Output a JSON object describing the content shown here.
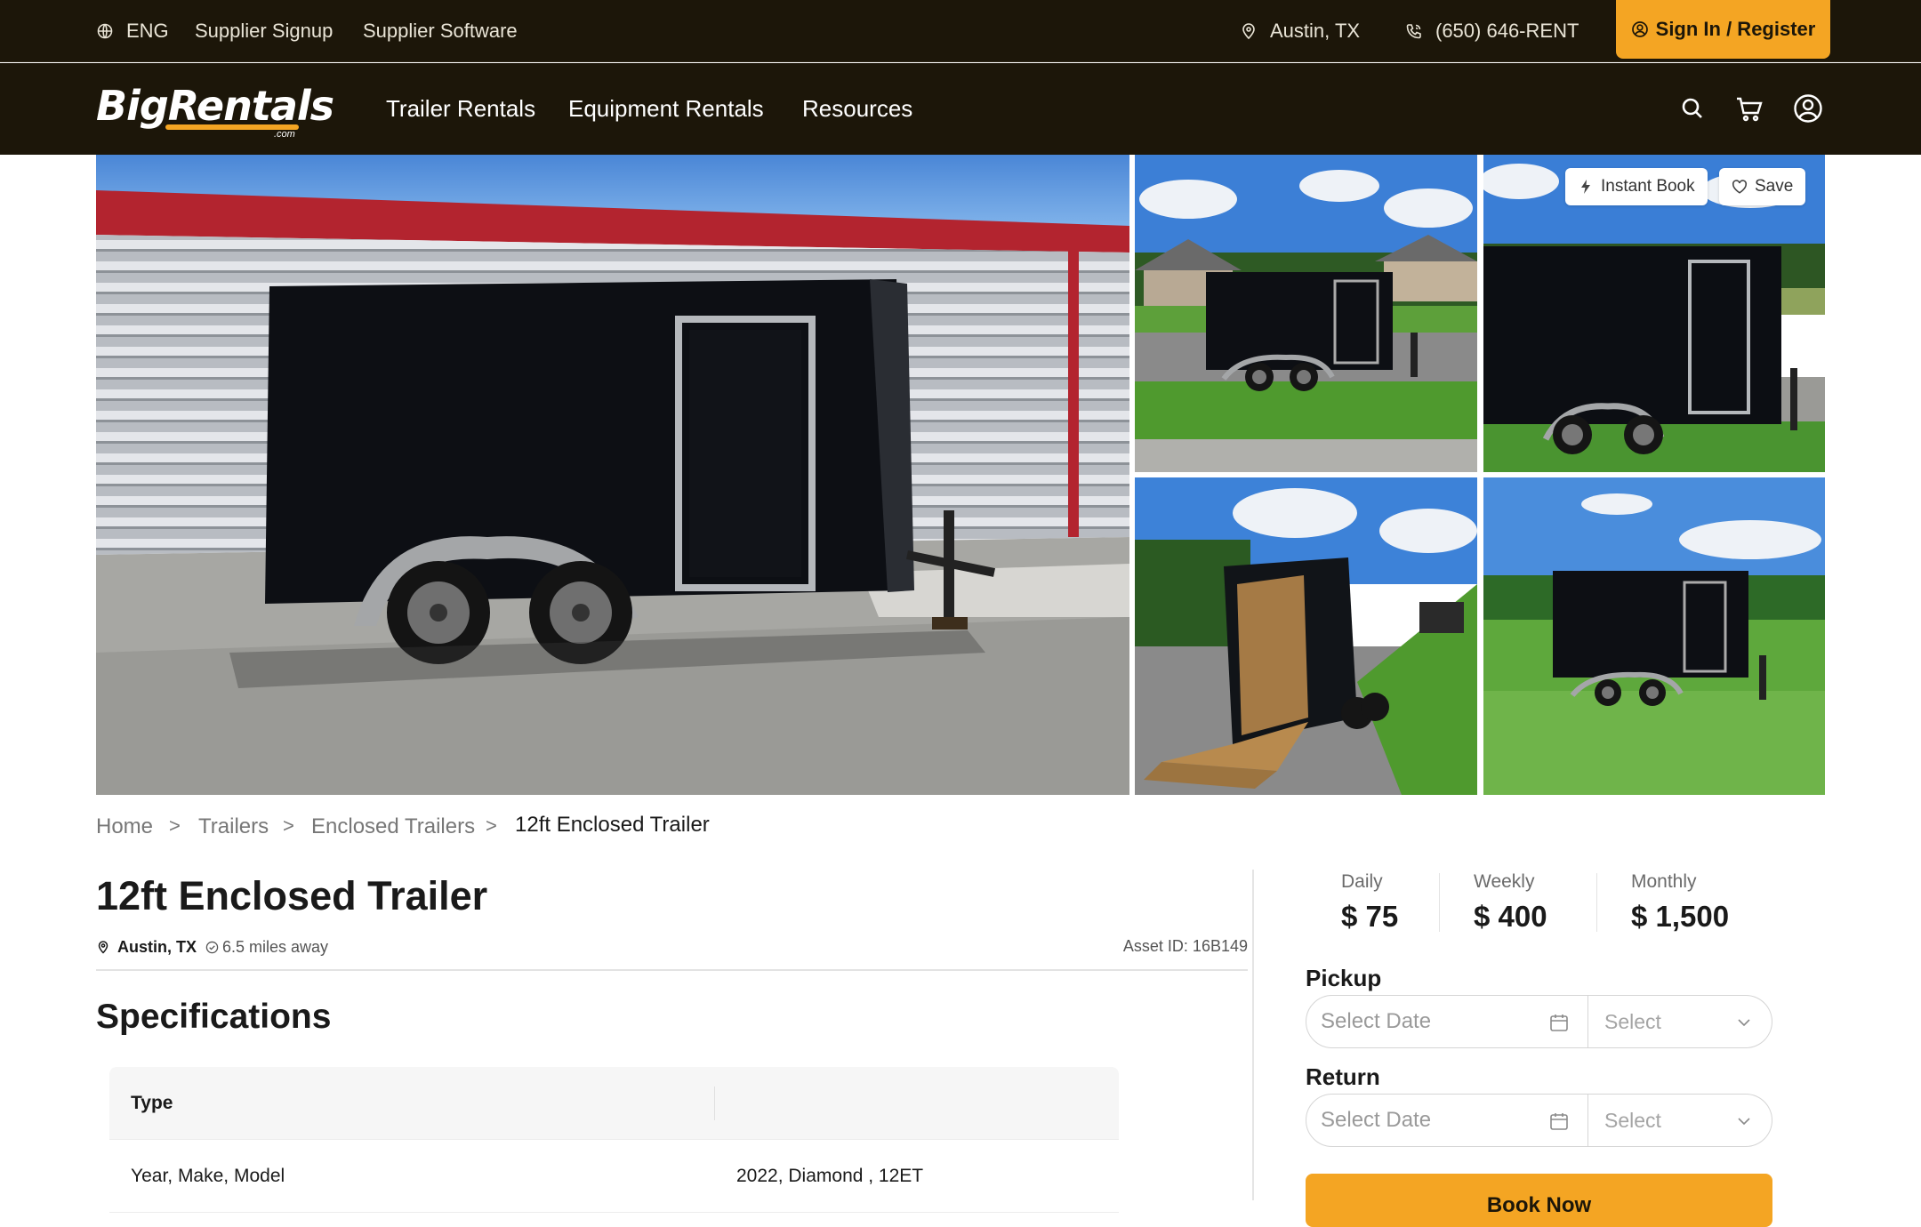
{
  "topbar": {
    "language": "ENG",
    "supplier_signup": "Supplier Signup",
    "supplier_software": "Supplier Software",
    "location": "Austin, TX",
    "phone": "(650) 646-RENT",
    "signin": "Sign In / Register"
  },
  "brand": {
    "logo_text": "BigRentals",
    "logo_suffix": ".com"
  },
  "nav": {
    "items": [
      "Trailer Rentals",
      "Equipment Rentals",
      "Resources"
    ],
    "icons": [
      "search-icon",
      "cart-icon",
      "user-circle-icon"
    ]
  },
  "gallery": {
    "instant_book": "Instant Book",
    "save": "Save",
    "photo_count": 5
  },
  "breadcrumb": [
    "Home",
    "Trailers",
    "Enclosed Trailers",
    "12ft Enclosed Trailer"
  ],
  "breadcrumb_separator": ">",
  "listing": {
    "title": "12ft Enclosed Trailer",
    "city": "Austin, TX",
    "distance": "6.5 miles away",
    "asset_id": "Asset ID: 16B149"
  },
  "specifications": {
    "heading": "Specifications",
    "rows": [
      {
        "key": "Type",
        "value": ""
      },
      {
        "key": "Year, Make, Model",
        "value": "2022, Diamond , 12ET"
      }
    ]
  },
  "pricing": {
    "daily_label": "Daily",
    "daily_value": "$ 75",
    "weekly_label": "Weekly",
    "weekly_value": "$ 400",
    "monthly_label": "Monthly",
    "monthly_value": "$ 1,500"
  },
  "booking": {
    "pickup_label": "Pickup",
    "return_label": "Return",
    "date_placeholder": "Select Date",
    "time_placeholder": "Select",
    "button_label": "Book Now"
  },
  "colors": {
    "header_bg": "#1c1609",
    "accent": "#f4a523",
    "text": "#1a1a1a"
  }
}
